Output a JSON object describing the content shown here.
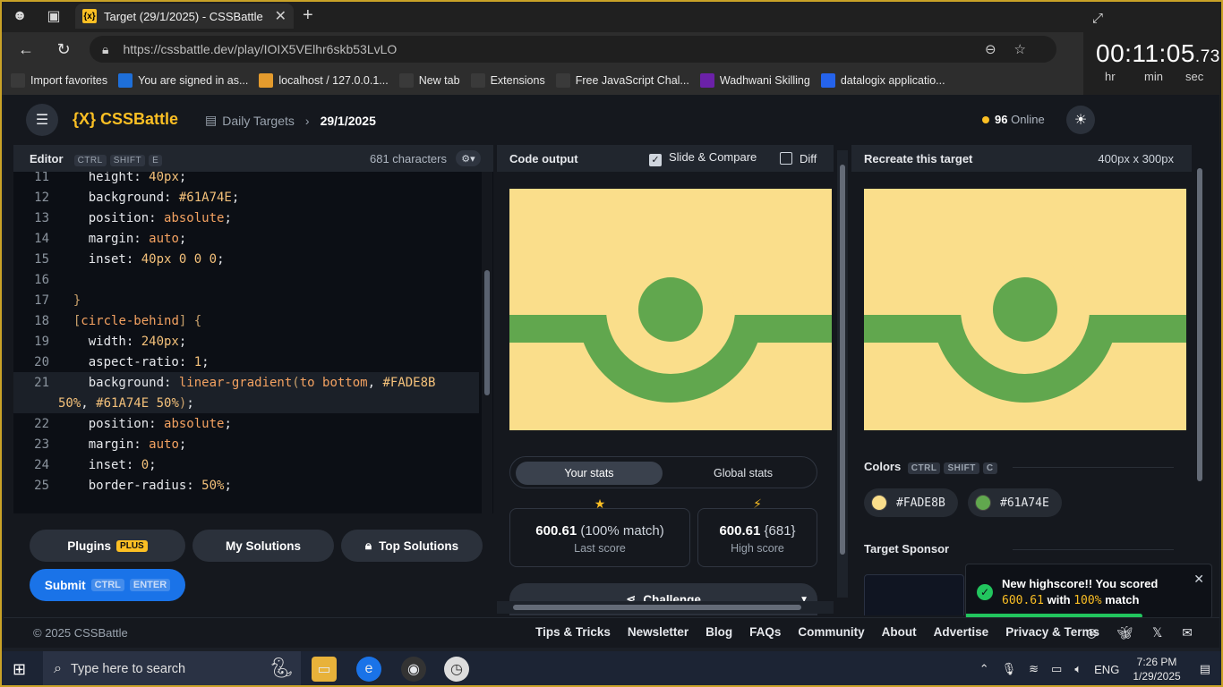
{
  "browser": {
    "tab_title": "Target (29/1/2025) - CSSBattle",
    "tab_favicon": "{x}",
    "url": "https://cssbattle.dev/play/IOIX5VElhr6skb53LvLO",
    "favorites": [
      {
        "label": "Import favorites",
        "icon": "import-icon",
        "color": "#3a3a3a"
      },
      {
        "label": "You are signed in as...",
        "icon": "s-icon",
        "color": "#1e6fd9"
      },
      {
        "label": "localhost / 127.0.0.1...",
        "icon": "phpmyadmin-icon",
        "color": "#e49b2d"
      },
      {
        "label": "New tab",
        "icon": "newtab-icon",
        "color": "#3a3a3a"
      },
      {
        "label": "Extensions",
        "icon": "puzzle-icon",
        "color": "#3a3a3a"
      },
      {
        "label": "Free JavaScript Chal...",
        "icon": "cube-icon",
        "color": "#3a3a3a"
      },
      {
        "label": "Wadhwani Skilling",
        "icon": "wadhwani-icon",
        "color": "#6b21a8"
      },
      {
        "label": "datalogix applicatio...",
        "icon": "doc-icon",
        "color": "#2563eb"
      }
    ]
  },
  "timer": {
    "time": "00:11:05",
    "ms": ".73",
    "units": [
      "hr",
      "min",
      "sec"
    ]
  },
  "header": {
    "logo": "{X} CSSBattle",
    "crumb_parent": "Daily Targets",
    "crumb_current": "29/1/2025",
    "online_count": "96",
    "online_label": "Online"
  },
  "editor": {
    "title": "Editor",
    "shortcut": [
      "CTRL",
      "SHIFT",
      "E"
    ],
    "chars": "681 characters",
    "lines": [
      {
        "n": "11",
        "parts": [
          [
            "p",
            "    height: "
          ],
          [
            "n",
            "40px"
          ],
          [
            "p",
            ";"
          ]
        ]
      },
      {
        "n": "12",
        "parts": [
          [
            "p",
            "    background: "
          ],
          [
            "n",
            "#61A74E"
          ],
          [
            "p",
            ";"
          ]
        ]
      },
      {
        "n": "13",
        "parts": [
          [
            "p",
            "    position: "
          ],
          [
            "v",
            "absolute"
          ],
          [
            "p",
            ";"
          ]
        ]
      },
      {
        "n": "14",
        "parts": [
          [
            "p",
            "    margin: "
          ],
          [
            "v",
            "auto"
          ],
          [
            "p",
            ";"
          ]
        ]
      },
      {
        "n": "15",
        "parts": [
          [
            "p",
            "    inset: "
          ],
          [
            "n",
            "40px"
          ],
          [
            "p",
            " "
          ],
          [
            "n",
            "0"
          ],
          [
            "p",
            " "
          ],
          [
            "n",
            "0"
          ],
          [
            "p",
            " "
          ],
          [
            "n",
            "0"
          ],
          [
            "p",
            ";"
          ]
        ]
      },
      {
        "n": "16",
        "parts": [
          [
            "p",
            ""
          ]
        ]
      },
      {
        "n": "17",
        "parts": [
          [
            "b",
            "  }"
          ]
        ]
      },
      {
        "n": "18",
        "parts": [
          [
            "p",
            "  "
          ],
          [
            "b",
            "["
          ],
          [
            "v",
            "circle-behind"
          ],
          [
            "b",
            "]"
          ],
          [
            "p",
            " "
          ],
          [
            "b",
            "{"
          ]
        ]
      },
      {
        "n": "19",
        "parts": [
          [
            "p",
            "    width: "
          ],
          [
            "n",
            "240px"
          ],
          [
            "p",
            ";"
          ]
        ]
      },
      {
        "n": "20",
        "parts": [
          [
            "p",
            "    aspect-ratio: "
          ],
          [
            "n",
            "1"
          ],
          [
            "p",
            ";"
          ]
        ]
      },
      {
        "n": "21",
        "parts": [
          [
            "p",
            "    background: "
          ],
          [
            "v",
            "linear-gradient"
          ],
          [
            "b",
            "("
          ],
          [
            "v",
            "to bottom"
          ],
          [
            "p",
            ", "
          ],
          [
            "n",
            "#FADE8B"
          ]
        ]
      },
      {
        "n": "",
        "parts": [
          [
            "n",
            "50%"
          ],
          [
            "p",
            ", "
          ],
          [
            "n",
            "#61A74E"
          ],
          [
            "p",
            " "
          ],
          [
            "n",
            "50%"
          ],
          [
            "b",
            ")"
          ],
          [
            "p",
            ";"
          ]
        ]
      },
      {
        "n": "22",
        "parts": [
          [
            "p",
            "    position: "
          ],
          [
            "v",
            "absolute"
          ],
          [
            "p",
            ";"
          ]
        ]
      },
      {
        "n": "23",
        "parts": [
          [
            "p",
            "    margin: "
          ],
          [
            "v",
            "auto"
          ],
          [
            "p",
            ";"
          ]
        ]
      },
      {
        "n": "24",
        "parts": [
          [
            "p",
            "    inset: "
          ],
          [
            "n",
            "0"
          ],
          [
            "p",
            ";"
          ]
        ]
      },
      {
        "n": "25",
        "parts": [
          [
            "p",
            "    border-radius: "
          ],
          [
            "n",
            "50%"
          ],
          [
            "p",
            ";"
          ]
        ]
      }
    ],
    "plugins_label": "Plugins",
    "plugins_badge": "PLUS",
    "my_solutions_label": "My Solutions",
    "top_solutions_label": "Top Solutions",
    "submit_label": "Submit",
    "submit_shortcut": [
      "CTRL",
      "ENTER"
    ]
  },
  "output": {
    "title": "Code output",
    "slide_compare": "Slide & Compare",
    "diff": "Diff",
    "tab_your_stats": "Your stats",
    "tab_global_stats": "Global stats",
    "last_score": "600.61",
    "last_match": "(100% match)",
    "last_score_label": "Last score",
    "high_score": "600.61",
    "high_chars": "{681}",
    "high_score_label": "High score",
    "challenge_label": "Challenge"
  },
  "target": {
    "title": "Recreate this target",
    "dimensions": "400px x 300px",
    "colors_title": "Colors",
    "colors_shortcut": [
      "CTRL",
      "SHIFT",
      "C"
    ],
    "colors": [
      {
        "hex": "#FADE8B"
      },
      {
        "hex": "#61A74E"
      }
    ],
    "sponsor_title": "Target Sponsor"
  },
  "toast": {
    "line1": "New highscore!! You scored",
    "score": "600.61",
    "with": "with",
    "match": "100%",
    "match_suffix": "match",
    "progress": 0.72
  },
  "footer": {
    "copyright": "© 2025 CSSBattle",
    "links": [
      "Tips & Tricks",
      "Newsletter",
      "Blog",
      "FAQs",
      "Community",
      "About",
      "Advertise",
      "Privacy & Terms"
    ]
  },
  "taskbar": {
    "search_placeholder": "Type here to search",
    "time": "7:26 PM",
    "date": "1/29/2025",
    "lang": "ENG"
  }
}
